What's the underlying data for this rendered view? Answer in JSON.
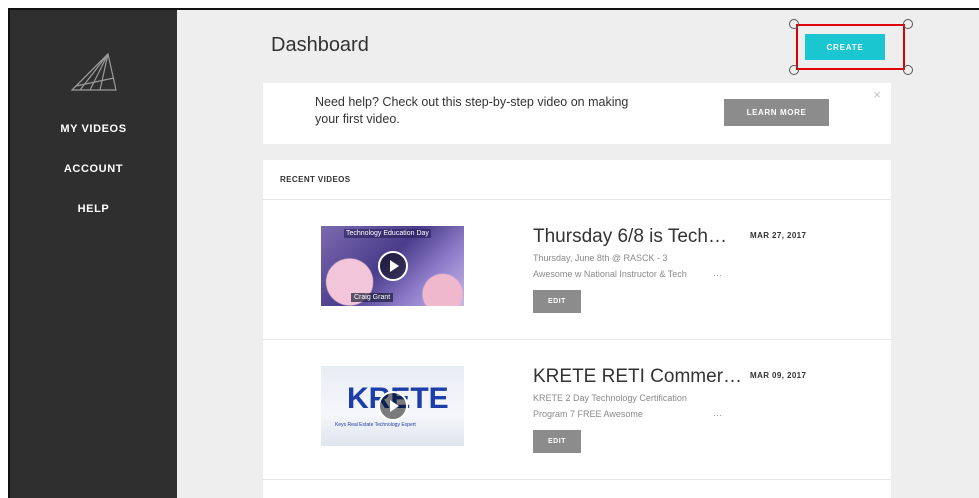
{
  "sidebar": {
    "logo": "paper-plane-logo",
    "items": [
      {
        "label": "MY VIDEOS"
      },
      {
        "label": "ACCOUNT"
      },
      {
        "label": "HELP"
      }
    ]
  },
  "header": {
    "title": "Dashboard",
    "create_label": "CREATE"
  },
  "help_banner": {
    "text": "Need help? Check out this step-by-step video on making your first video.",
    "button_label": "LEARN MORE",
    "close_icon": "×"
  },
  "recent_videos": {
    "heading": "RECENT VIDEOS",
    "items": [
      {
        "title": "Thursday 6/8 is Tech…",
        "line1": "Thursday, June 8th @ RASCK - 3",
        "line2": "Awesome w National Instructor & Tech",
        "ellipsis": "…",
        "date": "MAR 27, 2017",
        "edit_label": "EDIT",
        "thumb_caption_top": "Technology Education Day",
        "thumb_caption_bottom": "Craig Grant"
      },
      {
        "title": "KRETE RETI Commer…",
        "line1": "KRETE 2 Day Technology Certification",
        "line2": "Program 7 FREE Awesome",
        "ellipsis": "…",
        "date": "MAR 09, 2017",
        "edit_label": "EDIT",
        "thumb_brand": "KRETE",
        "thumb_tagline": "Keys Real Estate Technology Expert"
      }
    ]
  },
  "colors": {
    "sidebar_bg": "#2f2f2f",
    "accent": "#1ac6cf",
    "grey_button": "#8c8c8c",
    "highlight": "#e00000"
  }
}
